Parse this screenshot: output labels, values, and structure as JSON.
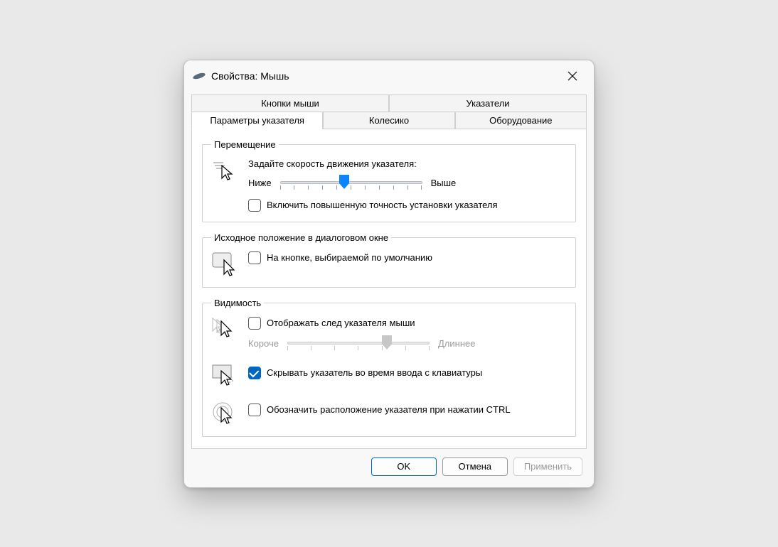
{
  "title": "Свойства: Мышь",
  "tabs": {
    "buttons": "Кнопки мыши",
    "pointers": "Указатели",
    "pointer_options": "Параметры указателя",
    "wheel": "Колесико",
    "hardware": "Оборудование"
  },
  "group_motion": {
    "legend": "Перемещение",
    "caption": "Задайте скорость движения указателя:",
    "slower": "Ниже",
    "faster": "Выше",
    "speed_position_percent": 45,
    "enhance_precision": {
      "checked": false,
      "label": "Включить повышенную точность установки указателя"
    }
  },
  "group_snapto": {
    "legend": "Исходное положение в диалоговом окне",
    "snap": {
      "checked": false,
      "label": "На кнопке, выбираемой по умолчанию"
    }
  },
  "group_visibility": {
    "legend": "Видимость",
    "trails": {
      "checked": false,
      "label": "Отображать след указателя мыши"
    },
    "trail_shorter": "Короче",
    "trail_longer": "Длиннее",
    "trail_position_percent": 70,
    "trail_enabled": false,
    "hide_while_typing": {
      "checked": true,
      "label": "Скрывать указатель во время ввода с клавиатуры"
    },
    "show_ctrl": {
      "checked": false,
      "label": "Обозначить расположение указателя при нажатии CTRL"
    }
  },
  "buttons_row": {
    "ok": "OK",
    "cancel": "Отмена",
    "apply": "Применить"
  }
}
